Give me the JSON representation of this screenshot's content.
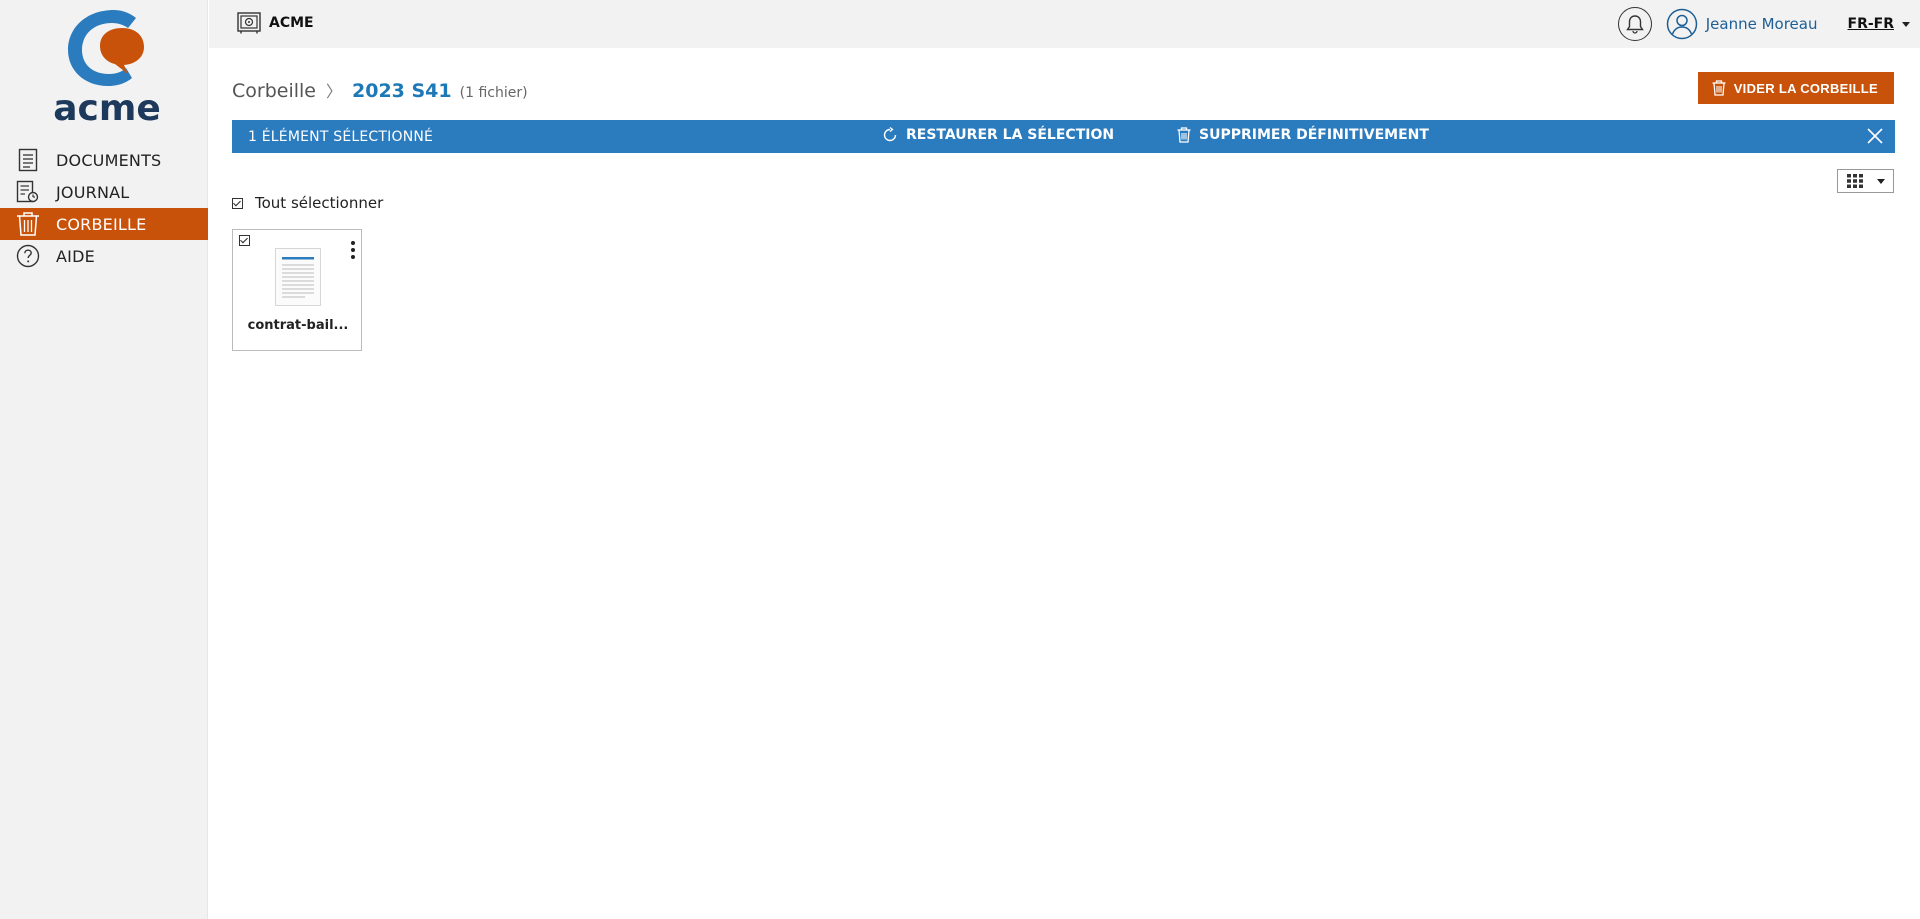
{
  "app": {
    "brand_name": "ACME",
    "logo_text": "acme"
  },
  "header": {
    "user_name": "Jeanne Moreau",
    "language": "FR-FR"
  },
  "sidebar": {
    "items": [
      {
        "label": "DOCUMENTS",
        "icon": "document-icon",
        "active": false
      },
      {
        "label": "JOURNAL",
        "icon": "journal-icon",
        "active": false
      },
      {
        "label": "CORBEILLE",
        "icon": "trash-icon",
        "active": true
      },
      {
        "label": "AIDE",
        "icon": "help-icon",
        "active": false
      }
    ]
  },
  "breadcrumb": {
    "root": "Corbeille",
    "separator": "〉",
    "current": "2023 S41",
    "count": "(1 fichier)"
  },
  "actions": {
    "empty_trash_label": "VIDER LA CORBEILLE"
  },
  "selection_bar": {
    "count_label": "1 ÉLÉMENT SÉLECTIONNÉ",
    "restore_label": "RESTAURER LA SÉLECTION",
    "delete_label": "SUPPRIMER DÉFINITIVEMENT"
  },
  "list": {
    "select_all_label": "Tout sélectionner",
    "files": [
      {
        "name": "contrat-bail...",
        "selected": true
      }
    ]
  },
  "colors": {
    "accent": "#c9520a",
    "selection_bar": "#2b7bbf",
    "link": "#1d78b8"
  }
}
